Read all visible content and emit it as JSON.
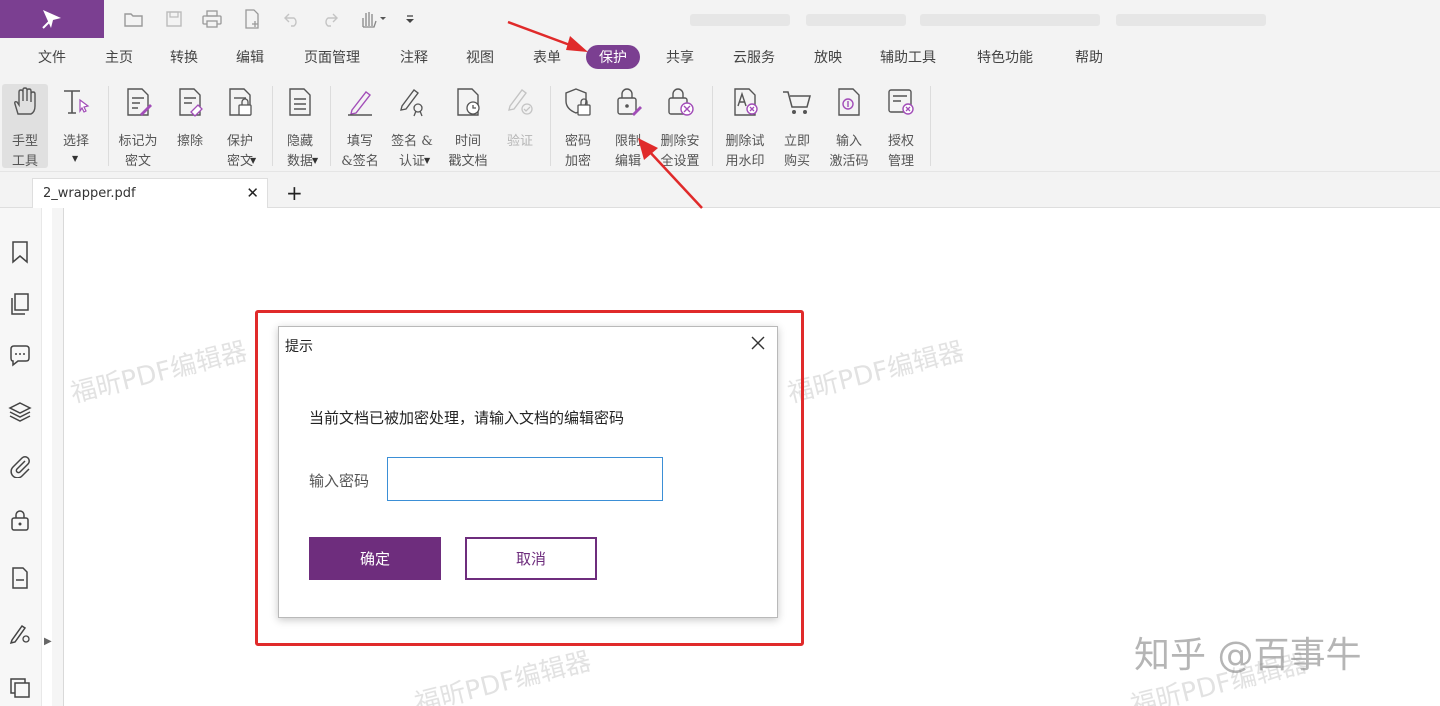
{
  "menubar": {
    "items": [
      "文件",
      "主页",
      "转换",
      "编辑",
      "页面管理",
      "注释",
      "视图",
      "表单",
      "保护",
      "共享",
      "云服务",
      "放映",
      "辅助工具",
      "特色功能",
      "帮助"
    ],
    "active_index": 8
  },
  "ribbon": {
    "tools": [
      {
        "label": "手型\n工具",
        "icon": "hand-icon"
      },
      {
        "label": "选择",
        "icon": "select-text-icon"
      },
      {
        "label": "标记为\n密文",
        "icon": "mark-redaction-icon"
      },
      {
        "label": "擦除",
        "icon": "erase-icon"
      },
      {
        "label": "保护\n密文",
        "icon": "protect-redaction-icon"
      },
      {
        "label": "隐藏\n数据",
        "icon": "hide-data-icon"
      },
      {
        "label": "填写\n&签名",
        "icon": "fill-sign-icon"
      },
      {
        "label": "签名 &\n认证",
        "icon": "sign-certify-icon"
      },
      {
        "label": "时间\n戳文档",
        "icon": "timestamp-icon"
      },
      {
        "label": "验证",
        "icon": "validate-icon"
      },
      {
        "label": "密码\n加密",
        "icon": "password-encrypt-icon"
      },
      {
        "label": "限制\n编辑",
        "icon": "restrict-editing-icon"
      },
      {
        "label": "删除安\n全设置",
        "icon": "remove-security-icon"
      },
      {
        "label": "删除试\n用水印",
        "icon": "remove-watermark-icon"
      },
      {
        "label": "立即\n购买",
        "icon": "cart-icon"
      },
      {
        "label": "输入\n激活码",
        "icon": "activation-code-icon"
      },
      {
        "label": "授权\n管理",
        "icon": "license-manage-icon"
      }
    ]
  },
  "tabs": {
    "document": "2_wrapper.pdf",
    "close_symbol": "✕",
    "add_symbol": "+"
  },
  "sidebar": {
    "icons": [
      "bookmark-icon",
      "pages-icon",
      "comments-icon",
      "layers-icon",
      "attachment-icon",
      "security-icon",
      "form-fields-icon",
      "signature-icon",
      "content-icon"
    ]
  },
  "watermark": {
    "text": "福昕PDF编辑器",
    "credit": "知乎 @百事牛"
  },
  "dialog": {
    "title": "提示",
    "message": "当前文档已被加密处理，请输入文档的编辑密码",
    "password_label": "输入密码",
    "password_value": "",
    "ok_label": "确定",
    "cancel_label": "取消"
  },
  "colors": {
    "brand_purple": "#7b3f91",
    "button_purple": "#6e2d7d",
    "highlight_red": "#e02a2a",
    "input_focus": "#3b8fd6"
  }
}
